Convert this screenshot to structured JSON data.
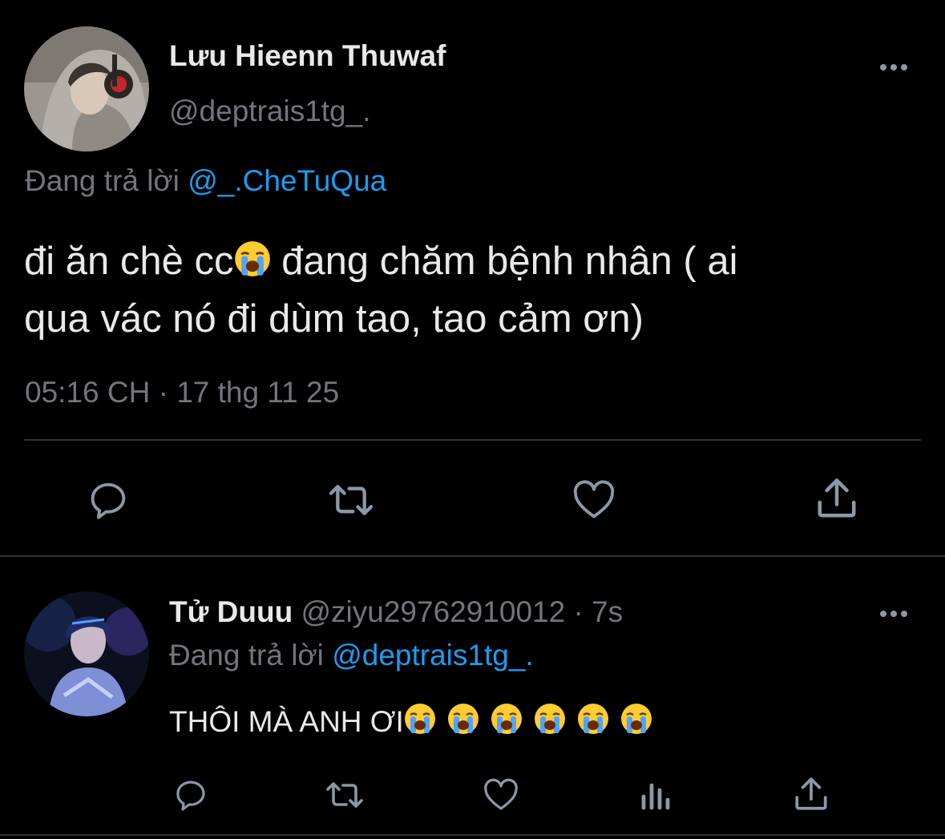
{
  "main_tweet": {
    "display_name": "Lưu Hieenn Thuwaf",
    "handle": "@deptrais1tg_.",
    "reply_prefix": "Đang trả lời",
    "reply_to": "@_.CheTuQua",
    "text_part1": "đi ăn chè cc",
    "text_part2": " đang chăm bệnh nhân ( ai",
    "text_line2": "qua vác nó đi dùm tao, tao cảm ơn)",
    "timestamp": "05:16 CH · 17 thg 11 25",
    "actions": [
      "reply-icon",
      "retweet-icon",
      "like-icon",
      "share-icon"
    ],
    "emoji": "loudly-crying-face"
  },
  "reply_tweet": {
    "display_name": "Tử Duuu",
    "handle_meta": "@ziyu29762910012 · 7s",
    "reply_prefix": "Đang trả lời",
    "reply_to": "@deptrais1tg_.",
    "text": "THÔI MÀ ANH ƠI",
    "emoji": "loudly-crying-face",
    "emoji_count": 6,
    "actions": [
      "reply-icon",
      "retweet-icon",
      "like-icon",
      "views-icon",
      "share-icon"
    ]
  },
  "colors": {
    "background": "#000000",
    "text": "#e7e9ea",
    "muted": "#71767b",
    "link": "#1d9bf0",
    "divider": "#2f3336"
  }
}
